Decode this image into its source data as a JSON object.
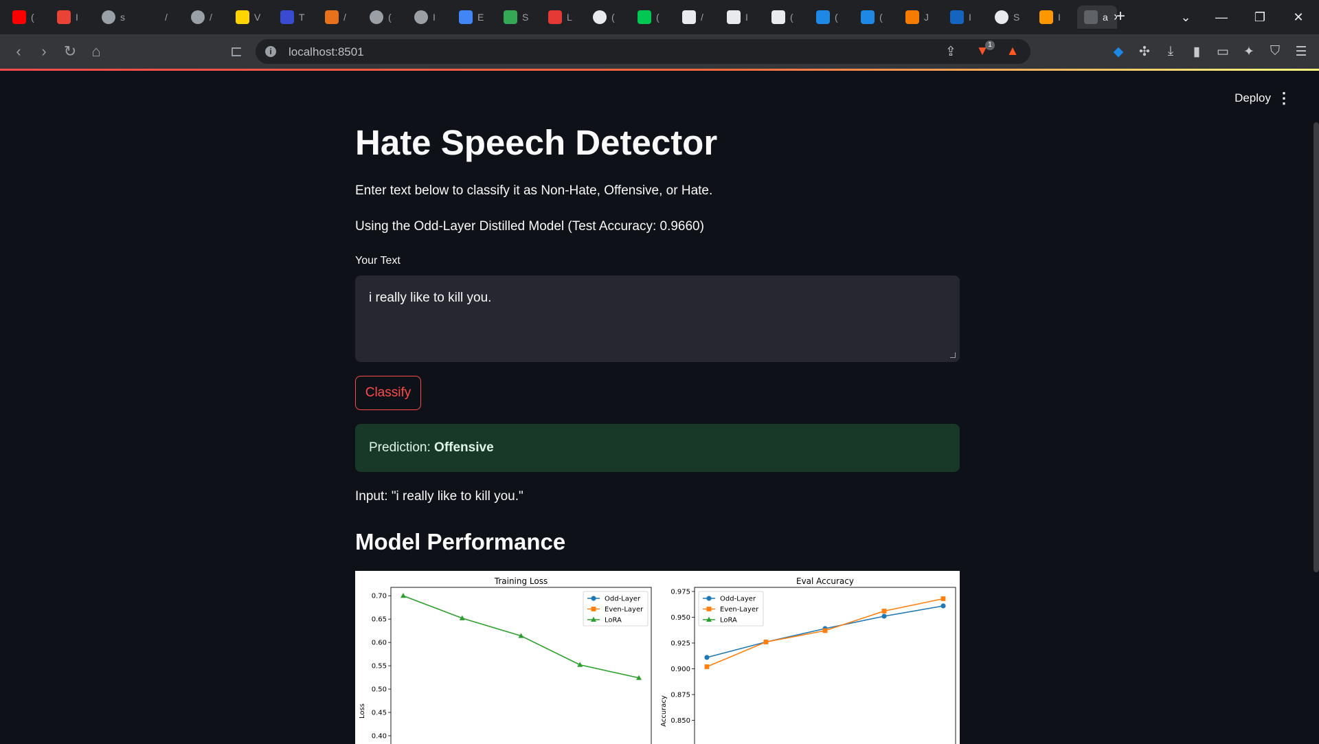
{
  "browser": {
    "tabs": [
      {
        "icon": "youtube-icon",
        "label": "(",
        "color": "#ff0000"
      },
      {
        "icon": "gmail-icon",
        "label": "I",
        "color": "#ea4335"
      },
      {
        "icon": "globe-icon",
        "label": "s",
        "color": "#9aa0a6"
      },
      {
        "icon": "blank-icon",
        "label": "/",
        "color": "#202124"
      },
      {
        "icon": "globe-icon",
        "label": "/",
        "color": "#9aa0a6"
      },
      {
        "icon": "ib-icon",
        "label": "V",
        "color": "#ffd400"
      },
      {
        "icon": "app-icon",
        "label": "T",
        "color": "#3b4bd1"
      },
      {
        "icon": "in-icon",
        "label": "/",
        "color": "#e8711c"
      },
      {
        "icon": "globe-icon",
        "label": "(",
        "color": "#9aa0a6"
      },
      {
        "icon": "globe-icon",
        "label": "I",
        "color": "#9aa0a6"
      },
      {
        "icon": "people-icon",
        "label": "E",
        "color": "#4285f4"
      },
      {
        "icon": "app-icon",
        "label": "S",
        "color": "#34a853"
      },
      {
        "icon": "crab-icon",
        "label": "L",
        "color": "#e53935"
      },
      {
        "icon": "openai-icon",
        "label": "(",
        "color": "#e8eaed"
      },
      {
        "icon": "leaf-icon",
        "label": "(",
        "color": "#00c853"
      },
      {
        "icon": "copilot-icon",
        "label": "/",
        "color": "#e8eaed"
      },
      {
        "icon": "slash-icon",
        "label": "I",
        "color": "#e8eaed"
      },
      {
        "icon": "slash-icon",
        "label": "(",
        "color": "#e8eaed"
      },
      {
        "icon": "k-icon",
        "label": "(",
        "color": "#1e88e5"
      },
      {
        "icon": "k-icon",
        "label": "(",
        "color": "#1e88e5"
      },
      {
        "icon": "jupyter-icon",
        "label": "J",
        "color": "#f57c00"
      },
      {
        "icon": "app-icon",
        "label": "I",
        "color": "#1565c0"
      },
      {
        "icon": "github-icon",
        "label": "S",
        "color": "#e8eaed"
      },
      {
        "icon": "infinity-icon",
        "label": "I",
        "color": "#ff9800"
      },
      {
        "icon": "app-icon",
        "label": "a",
        "color": "#5f6368",
        "active": true
      }
    ],
    "url": "localhost:8501",
    "extension_badge": "1"
  },
  "app": {
    "deploy_label": "Deploy",
    "title": "Hate Speech Detector",
    "description": "Enter text below to classify it as Non-Hate, Offensive, or Hate.",
    "model_info": "Using the Odd-Layer Distilled Model (Test Accuracy: 0.9660)",
    "input_label": "Your Text",
    "input_value": "i really like to kill you.",
    "classify_label": "Classify",
    "prediction_prefix": "Prediction: ",
    "prediction_value": "Offensive",
    "input_echo": "Input: \"i really like to kill you.\"",
    "performance_heading": "Model Performance"
  },
  "colors": {
    "accent": "#ff4b4b",
    "success_bg": "#183828",
    "series_odd": "#1f77b4",
    "series_even": "#ff7f0e",
    "series_lora": "#2ca02c"
  },
  "chart_data": [
    {
      "type": "line",
      "title": "Training Loss",
      "xlabel": "",
      "ylabel": "Loss",
      "ylim": [
        0.4,
        0.72
      ],
      "yticks": [
        "0.70",
        "0.65",
        "0.60",
        "0.55",
        "0.50",
        "0.45",
        "0.40"
      ],
      "x": [
        1,
        2,
        3,
        4,
        5
      ],
      "series": [
        {
          "name": "LoRA",
          "values": [
            0.7,
            0.652,
            0.614,
            0.552,
            0.524
          ]
        }
      ],
      "legend": [
        "Odd-Layer",
        "Even-Layer",
        "LoRA"
      ],
      "legend_position": "top-right"
    },
    {
      "type": "line",
      "title": "Eval Accuracy",
      "xlabel": "",
      "ylabel": "Accuracy",
      "ylim": [
        0.835,
        0.975
      ],
      "yticks": [
        "0.975",
        "0.950",
        "0.925",
        "0.900",
        "0.875",
        "0.850"
      ],
      "x": [
        1,
        2,
        3,
        4,
        5
      ],
      "series": [
        {
          "name": "Odd-Layer",
          "values": [
            0.911,
            0.926,
            0.939,
            0.951,
            0.961
          ]
        },
        {
          "name": "Even-Layer",
          "values": [
            0.902,
            0.926,
            0.937,
            0.956,
            0.968
          ]
        }
      ],
      "legend": [
        "Odd-Layer",
        "Even-Layer",
        "LoRA"
      ],
      "legend_position": "top-left"
    }
  ]
}
